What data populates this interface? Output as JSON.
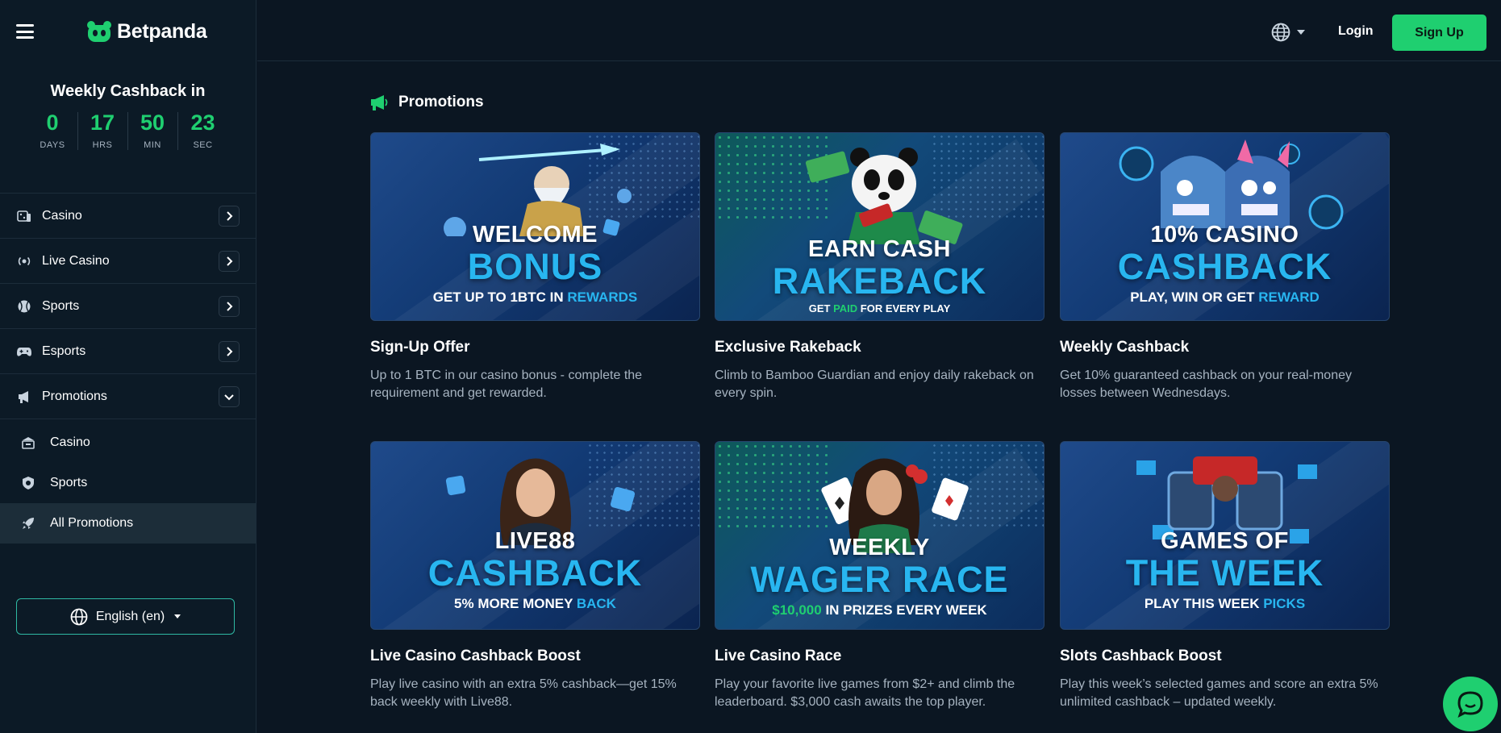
{
  "brand": {
    "name": "Betpanda",
    "accent": "#1fcf70",
    "highlight": "#28b6f0"
  },
  "cashback": {
    "title": "Weekly Cashback in",
    "countdown": [
      {
        "value": "0",
        "label": "DAYS"
      },
      {
        "value": "17",
        "label": "HRS"
      },
      {
        "value": "50",
        "label": "MIN"
      },
      {
        "value": "23",
        "label": "SEC"
      }
    ]
  },
  "sidebar": {
    "items": [
      {
        "label": "Casino",
        "icon": "casino-icon"
      },
      {
        "label": "Live Casino",
        "icon": "live-broadcast-icon"
      },
      {
        "label": "Sports",
        "icon": "sports-ball-icon"
      },
      {
        "label": "Esports",
        "icon": "gamepad-icon"
      },
      {
        "label": "Promotions",
        "icon": "megaphone-icon"
      }
    ],
    "sub_items": [
      {
        "label": "Casino",
        "icon": "building-icon"
      },
      {
        "label": "Sports",
        "icon": "shield-ball-icon"
      },
      {
        "label": "All Promotions",
        "icon": "rocket-icon"
      }
    ],
    "language": "English (en)"
  },
  "header": {
    "login": "Login",
    "signup": "Sign Up"
  },
  "section": {
    "title": "Promotions"
  },
  "cards": [
    {
      "title": "Sign-Up Offer",
      "desc": "Up to 1 BTC in our casino bonus - complete the requirement and get rewarded.",
      "banner": {
        "line1": "WELCOME",
        "line2": "BONUS",
        "line3a": "GET UP TO 1BTC IN ",
        "line3b": "REWARDS"
      }
    },
    {
      "title": "Exclusive Rakeback",
      "desc": "Climb to Bamboo Guardian and enjoy daily rakeback on every spin.",
      "banner": {
        "line1": "EARN CASH",
        "line2": "RAKEBACK",
        "line3a": "GET ",
        "line3b": "PAID",
        "line3c": " FOR EVERY PLAY"
      }
    },
    {
      "title": "Weekly Cashback",
      "desc": "Get 10% guaranteed cashback on your real-money losses between Wednesdays.",
      "banner": {
        "line1": "10% CASINO",
        "line2": "CASHBACK",
        "line3a": "PLAY, WIN OR GET ",
        "line3b": "REWARD"
      }
    },
    {
      "title": "Live Casino Cashback Boost",
      "desc": "Play live casino with an extra 5% cashback—get 15% back weekly with Live88.",
      "banner": {
        "line1": "LIVE88",
        "line2": "CASHBACK",
        "line3a": "5% MORE MONEY ",
        "line3b": "BACK"
      }
    },
    {
      "title": "Live Casino Race",
      "desc": "Play your favorite live games from $2+ and climb the leaderboard. $3,000 cash awaits the top player.",
      "banner": {
        "line1": "WEEKLY",
        "line2": "WAGER RACE",
        "line3a": "$10,000",
        "line3b": " IN PRIZES EVERY WEEK"
      }
    },
    {
      "title": "Slots Cashback Boost",
      "desc": "Play this week’s selected games and score an extra 5% unlimited cashback – updated weekly.",
      "banner": {
        "line1": "GAMES OF",
        "line2": "THE WEEK",
        "line3a": "PLAY THIS WEEK ",
        "line3b": "PICKS"
      }
    }
  ]
}
